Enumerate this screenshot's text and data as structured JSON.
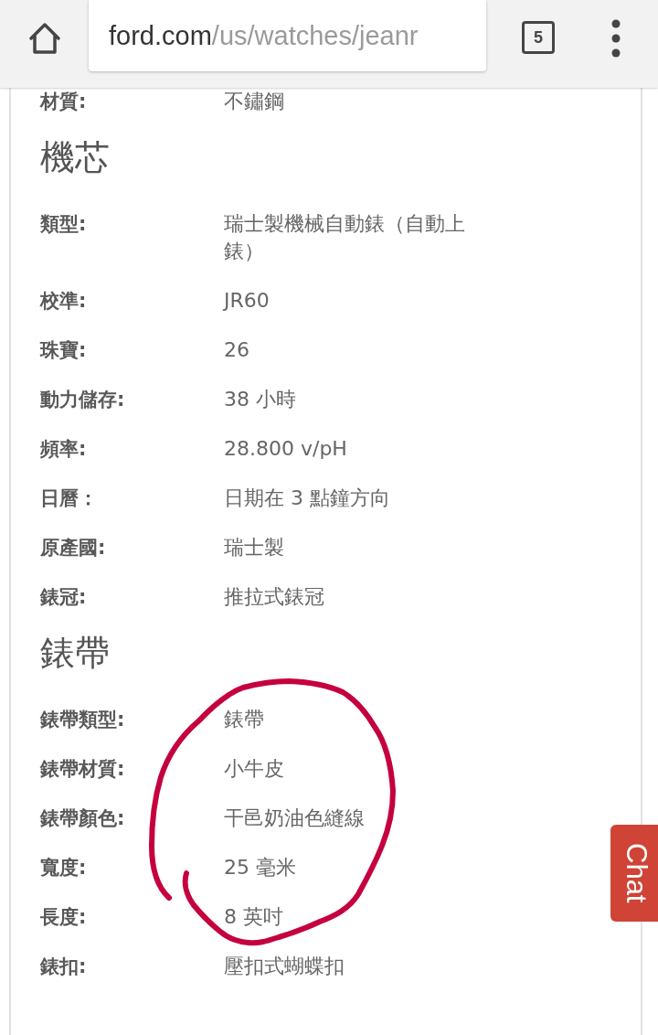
{
  "browser_bar": {
    "url_host": "ford.com",
    "url_path": "/us/watches/jeanr",
    "tab_count": "5"
  },
  "spec_sections": [
    {
      "rows": [
        {
          "label": "材質:",
          "value": "不鏽鋼"
        }
      ]
    },
    {
      "title": "機芯",
      "rows": [
        {
          "label": "類型:",
          "value": "瑞士製機械自動錶（自動上錶）"
        },
        {
          "label": "校準:",
          "value": "JR60"
        },
        {
          "label": "珠寶:",
          "value": "26"
        },
        {
          "label": "動力儲存:",
          "value": "38 小時"
        },
        {
          "label": "頻率:",
          "value": "28.800 v/pH"
        },
        {
          "label": "日曆：",
          "value": "日期在 3 點鐘方向"
        },
        {
          "label": "原產國:",
          "value": "瑞士製"
        },
        {
          "label": "錶冠:",
          "value": "推拉式錶冠"
        }
      ]
    },
    {
      "title": "錶帶",
      "rows": [
        {
          "label": "錶帶類型:",
          "value": "錶帶"
        },
        {
          "label": "錶帶材質:",
          "value": "小牛皮"
        },
        {
          "label": "錶帶顏色:",
          "value": "干邑奶油色縫線"
        },
        {
          "label": "寬度:",
          "value": "25 毫米"
        },
        {
          "label": "長度:",
          "value": "8 英吋"
        },
        {
          "label": "錶扣:",
          "value": "壓扣式蝴蝶扣"
        }
      ]
    }
  ],
  "chat_tab": {
    "label": "Chat"
  },
  "annotations": [
    {
      "kind": "ink-circle"
    }
  ]
}
